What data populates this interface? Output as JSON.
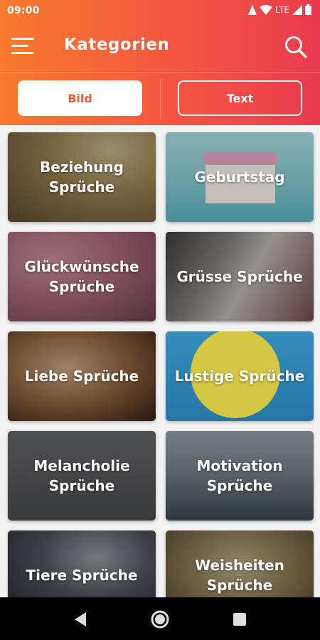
{
  "status_bar": {
    "time": "09:00",
    "network": "LTE",
    "icons": [
      "alarm-icon",
      "wifi-icon",
      "signal-icon",
      "battery-icon"
    ]
  },
  "app_bar": {
    "title": "Kategorien",
    "menu_icon": "hamburger-menu-icon",
    "search_icon": "search-icon"
  },
  "toggle": {
    "bild_label": "Bild",
    "text_label": "Text",
    "selected": "Bild"
  },
  "categories": [
    {
      "label": "Beziehung\nSprüche"
    },
    {
      "label": "Geburtstag"
    },
    {
      "label": "Glückwünsche\nSprüche"
    },
    {
      "label": "Grüsse Sprüche"
    },
    {
      "label": "Liebe Sprüche"
    },
    {
      "label": "Lustige Sprüche"
    },
    {
      "label": "Melancholie\nSprüche"
    },
    {
      "label": "Motivation\nSprüche"
    },
    {
      "label": "Tiere Sprüche"
    },
    {
      "label": "Weisheiten\nSprüche"
    }
  ],
  "nav_bar": {
    "icons": [
      "back-icon",
      "home-icon",
      "recent-apps-icon"
    ]
  },
  "colors": {
    "gradient_start": "#f77a2c",
    "gradient_mid": "#f4593f",
    "gradient_end": "#ea3b4e",
    "bild_text": "#f25a3a",
    "white": "#ffffff",
    "nav_bar": "#000000"
  }
}
